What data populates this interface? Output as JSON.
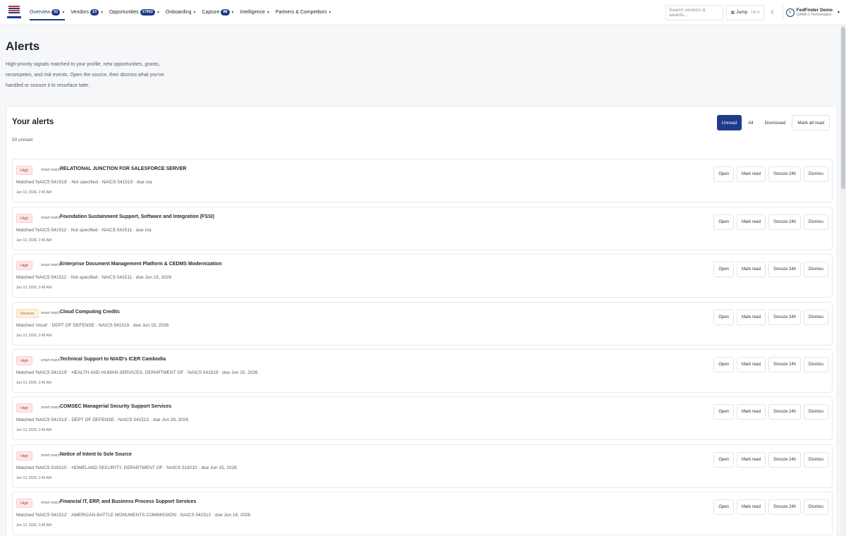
{
  "nav": {
    "items": [
      {
        "label": "Overview",
        "badge": "51",
        "active": true
      },
      {
        "label": "Vendors",
        "badge": "13",
        "active": false
      },
      {
        "label": "Opportunities",
        "badge": "17952",
        "active": false
      },
      {
        "label": "Onboarding",
        "badge": "",
        "active": false
      },
      {
        "label": "Capture",
        "badge": "88",
        "active": false
      },
      {
        "label": "Intelligence",
        "badge": "",
        "active": false
      },
      {
        "label": "Partners & Competitors",
        "badge": "",
        "active": false
      }
    ],
    "search_placeholder": "Search vendors & awards...",
    "jump_label": "Jump",
    "jump_shortcut": "Ctrl K",
    "user_name": "FedFinder Demo",
    "user_org": "GAMA-1 Technologies",
    "avatar_initial": "F"
  },
  "header": {
    "title": "Alerts",
    "description": "High-priority signals matched to your profile, new opportunities, grants, recompetes, and risk events. Open the source, then dismiss what you've handled or snooze it to resurface later."
  },
  "panel": {
    "title": "Your alerts",
    "unread_count": "50 unread",
    "filters": [
      "Unread",
      "All",
      "Dismissed"
    ],
    "mark_all_label": "Mark all read"
  },
  "action_labels": {
    "open": "Open",
    "mark_read": "Mark read",
    "snooze": "Snooze 24h",
    "dismiss": "Dismiss"
  },
  "alerts": [
    {
      "severity": "High",
      "kind": "smart match",
      "title": "RELATIONAL JUNCTION FOR SALESFORCE SERVER",
      "detail": "Matched 'NAICS 541519' · Not specified · NAICS 541519 · due n/a",
      "time": "Jun 13, 2026, 2:45 AM"
    },
    {
      "severity": "High",
      "kind": "smart match",
      "title": "Foundation Sustainment Support, Software and Integration (FSSI)",
      "detail": "Matched 'NAICS 541511' · Not specified · NAICS 541511 · due n/a",
      "time": "Jun 13, 2026, 2:45 AM"
    },
    {
      "severity": "High",
      "kind": "smart match",
      "title": "Enterprise Document Management Platform & CEDMS Modernization",
      "detail": "Matched 'NAICS 541511' · Not specified · NAICS 541511 · due Jun 15, 2026",
      "time": "Jun 13, 2026, 2:45 AM"
    },
    {
      "severity": "Medium",
      "kind": "smart match",
      "title": "Cloud Computing Credits",
      "detail": "Matched 'cloud' · DEPT OF DEFENSE · NAICS 541519 · due Jun 15, 2026",
      "time": "Jun 13, 2026, 2:45 AM"
    },
    {
      "severity": "High",
      "kind": "smart match",
      "title": "Technical Support to NIAID's ICER Cambodia",
      "detail": "Matched 'NAICS 541519' · HEALTH AND HUMAN SERVICES, DEPARTMENT OF · NAICS 541519 · due Jun 15, 2026",
      "time": "Jun 13, 2026, 2:45 AM"
    },
    {
      "severity": "High",
      "kind": "smart match",
      "title": "COMSEC Managerial Security Support Services",
      "detail": "Matched 'NAICS 541513' · DEPT OF DEFENSE · NAICS 541513 · due Jun 29, 2026",
      "time": "Jun 13, 2026, 2:45 AM"
    },
    {
      "severity": "High",
      "kind": "smart match",
      "title": "Notice of Intent to Sole Source",
      "detail": "Matched 'NAICS 518210' · HOMELAND SECURITY, DEPARTMENT OF · NAICS 518210 · due Jun 15, 2026",
      "time": "Jun 13, 2026, 2:45 AM"
    },
    {
      "severity": "High",
      "kind": "smart match",
      "title": "Financial IT, ERP, and Business Process Support Services",
      "detail": "Matched 'NAICS 541512' · AMERICAN BATTLE MONUMENTS COMMISSION · NAICS 541512 · due Jun 18, 2026",
      "time": "Jun 13, 2026, 2:45 AM"
    }
  ]
}
